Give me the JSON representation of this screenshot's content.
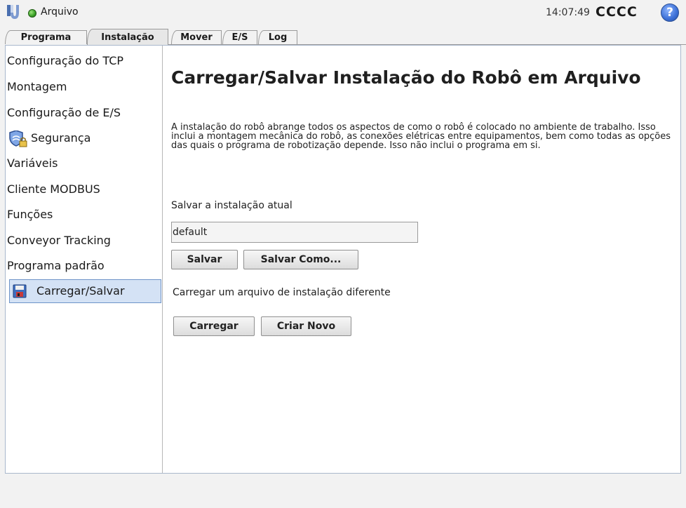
{
  "header": {
    "file_title": "Arquivo",
    "clock": "14:07:49",
    "robot_name": "CCCC",
    "help_symbol": "?",
    "status_color": "#3fa52a"
  },
  "tabs": [
    {
      "label": "Programa",
      "active": false
    },
    {
      "label": "Instalação",
      "active": true
    },
    {
      "label": "Mover",
      "active": false
    },
    {
      "label": "E/S",
      "active": false
    },
    {
      "label": "Log",
      "active": false
    }
  ],
  "sidebar": {
    "items": [
      {
        "label": "Configuração do TCP"
      },
      {
        "label": "Montagem"
      },
      {
        "label": "Configuração de E/S"
      },
      {
        "label": "Segurança",
        "icon": "shield-lock-icon"
      },
      {
        "label": "Variáveis"
      },
      {
        "label": "Cliente MODBUS"
      },
      {
        "label": "Funções"
      },
      {
        "label": "Conveyor Tracking"
      },
      {
        "label": "Programa padrão"
      },
      {
        "label": "Carregar/Salvar",
        "icon": "floppy-disk-icon",
        "active": true
      }
    ]
  },
  "main": {
    "title": "Carregar/Salvar Instalação do Robô em Arquivo",
    "description": "A instalação do robô abrange todos os aspectos de como o robô é colocado no ambiente de trabalho. Isso inclui a montagem mecânica do robô, as conexões elétricas entre equipamentos, bem como todas as opções das quais o programa de robotização depende. Isso não inclui o programa em si.",
    "save_label": "Salvar a instalação atual",
    "filename_value": "default",
    "save_button": "Salvar",
    "save_as_button": "Salvar Como...",
    "load_label": "Carregar um arquivo de instalação diferente",
    "load_button": "Carregar",
    "new_button": "Criar Novo"
  },
  "colors": {
    "accent_selection": "#d4e2f5",
    "selection_border": "#6e94c8"
  }
}
